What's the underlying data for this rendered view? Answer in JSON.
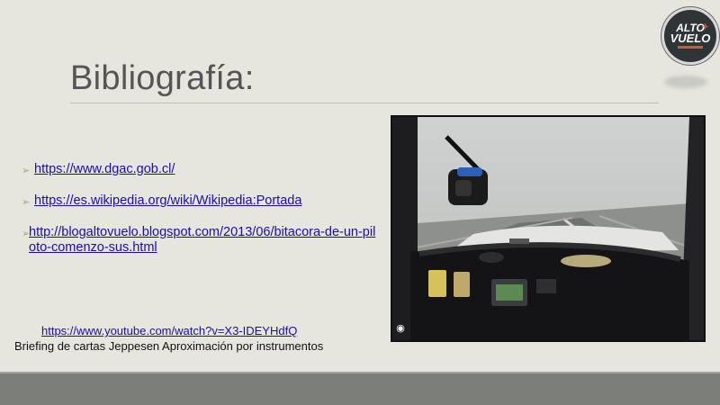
{
  "slide": {
    "title": "Bibliografía:",
    "logo": {
      "line1": "ALTO",
      "line2": "VUELO",
      "icon": "plane-icon"
    },
    "bullets": [
      {
        "text": "https://www.dgac.gob.cl/",
        "icon": "arrow-bullet-icon"
      },
      {
        "text": "https://es.wikipedia.org/wiki/Wikipedia:Portada",
        "icon": "arrow-bullet-icon"
      },
      {
        "text": "http://blogaltovuelo.blogspot.com/2013/06/bitacora-de-un-piloto-comenzo-sus.html",
        "icon": "arrow-bullet-icon"
      }
    ],
    "youtube_link": "https://www.youtube.com/watch?v=X3-IDEYHdfQ",
    "caption": "Briefing de cartas Jeppesen Aproximación por instrumentos",
    "photo_icon": "lens-icon",
    "colors": {
      "background": "#e6e6df",
      "footer": "#7b7e79",
      "link": "#1a0dab",
      "bullet": "#9aaa7a"
    }
  }
}
